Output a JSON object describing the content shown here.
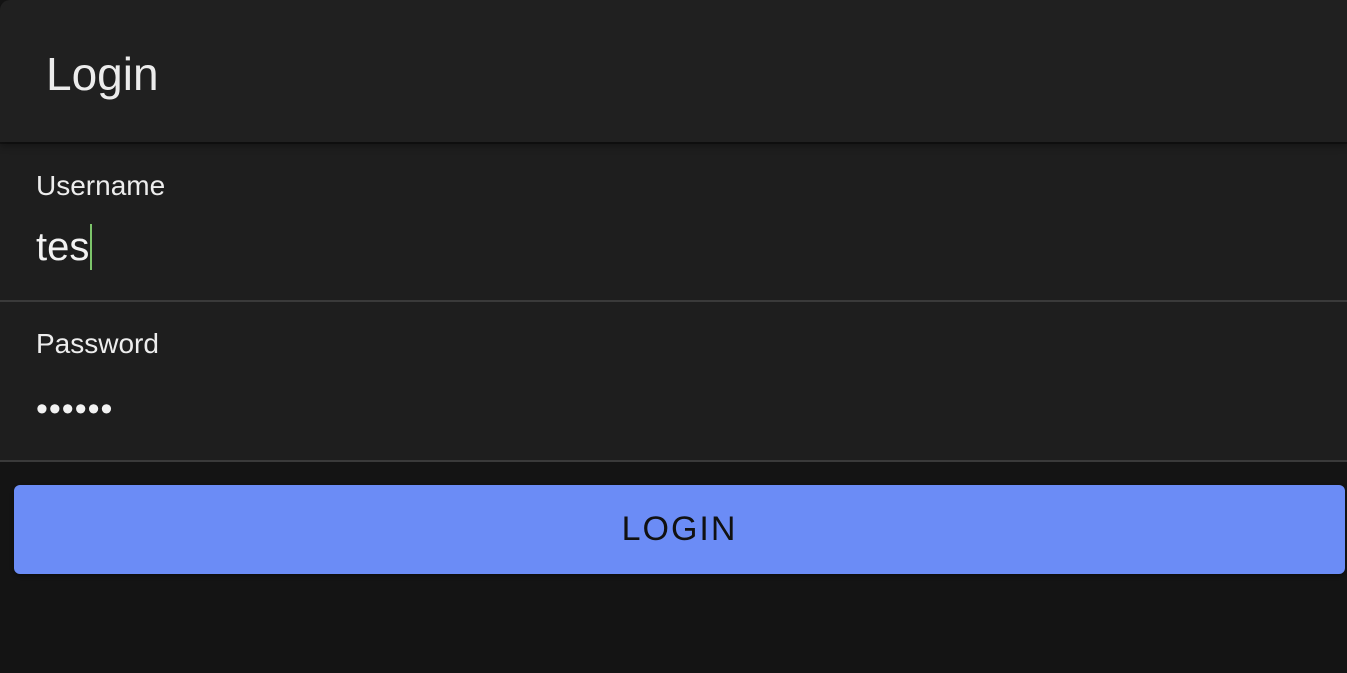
{
  "header": {
    "title": "Login"
  },
  "form": {
    "username": {
      "label": "Username",
      "value": "tes"
    },
    "password": {
      "label": "Password",
      "value": "••••••"
    },
    "login_button_label": "LOGIN"
  },
  "colors": {
    "accent": "#6b8cf6",
    "caret": "#7cc46a",
    "background": "#141414",
    "surface": "#1e1e1e"
  }
}
